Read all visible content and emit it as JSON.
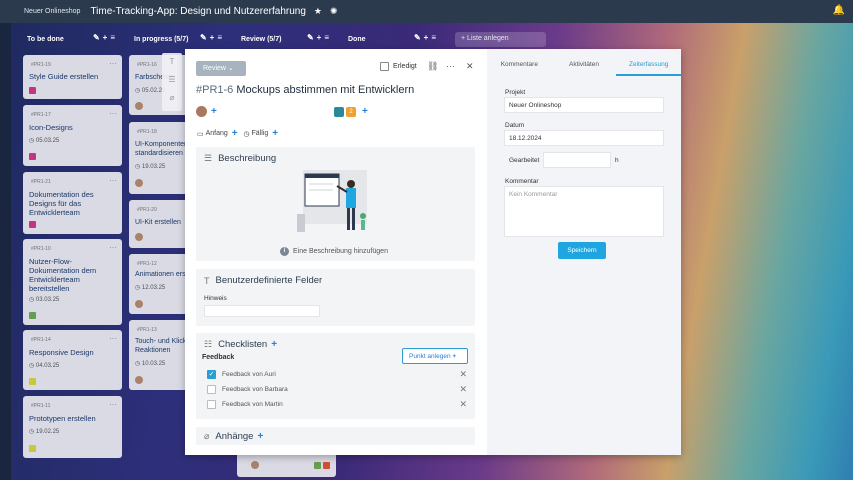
{
  "topbar": {
    "workspace": "Neuer Onlineshop",
    "title": "Time-Tracking-App: Design und Nutzererfahrung"
  },
  "columns": [
    {
      "name": "To be done",
      "count": ""
    },
    {
      "name": "In progress",
      "count": "(5/7)"
    },
    {
      "name": "Review",
      "count": "(5/7)"
    },
    {
      "name": "Done",
      "count": ""
    }
  ],
  "add_list": "Liste anlegen",
  "todo_cards": [
    {
      "id": "#PR1-19",
      "title": "Style Guide erstellen",
      "date": "",
      "color": "#d63384"
    },
    {
      "id": "#PR1-17",
      "title": "Icon-Designs",
      "date": "05.03.25",
      "color": "#d63384"
    },
    {
      "id": "#PR1-21",
      "title": "Dokumentation des Designs für das Entwicklerteam",
      "date": "",
      "color": "#d63384"
    },
    {
      "id": "#PR1-10",
      "title": "Nutzer-Flow-Dokumentation dem Entwicklerteam bereitstellen",
      "date": "03.03.25",
      "color": "#6aa84f"
    },
    {
      "id": "#PR1-14",
      "title": "Responsive Design",
      "date": "04.03.25",
      "color": "#d6d63a"
    },
    {
      "id": "#PR1-11",
      "title": "Prototypen erstellen",
      "date": "19.02.25",
      "color": "#d6d63a"
    }
  ],
  "progress_cards": [
    {
      "id": "#PR1-16",
      "title": "Farbschema",
      "date": "05.02.25"
    },
    {
      "id": "#PR1-18",
      "title": "UI-Komponenten standardisieren",
      "date": "19.03.25"
    },
    {
      "id": "#PR1-20",
      "title": "UI-Kit erstellen",
      "date": ""
    },
    {
      "id": "#PR1-12",
      "title": "Animationen erstellen",
      "date": "12.03.25"
    },
    {
      "id": "#PR1-13",
      "title": "Touch- und Klick-Reaktionen definieren",
      "date": "10.03.25"
    }
  ],
  "modal": {
    "status": "Review",
    "erledigt": "Erledigt",
    "task_id": "#PR1-6",
    "task_title": "Mockups abstimmen mit Entwicklern",
    "tag_count": "2",
    "anfang": "Anfang",
    "faellig": "Fällig",
    "beschreibung": "Beschreibung",
    "add_description": "Eine Beschreibung hinzufügen",
    "custom_fields": "Benutzerdefinierte Felder",
    "hinweis": "Hinweis",
    "checklisten": "Checklisten",
    "feedback": "Feedback",
    "punkt_anlegen": "Punkt anlegen",
    "checklist_items": [
      {
        "label": "Feedback von Auri",
        "done": true
      },
      {
        "label": "Feedback von Barbara",
        "done": false
      },
      {
        "label": "Feedback von Martin",
        "done": false
      }
    ],
    "anhaenge": "Anhänge"
  },
  "right": {
    "tabs": [
      "Kommentare",
      "Aktivitäten",
      "Zeiterfassung"
    ],
    "projekt_label": "Projekt",
    "projekt_value": "Neuer Onlineshop",
    "datum_label": "Datum",
    "datum_value": "18.12.2024",
    "gearbeitet_label": "Gearbeitet",
    "gearbeitet_unit": "h",
    "kommentar_label": "Kommentar",
    "kommentar_placeholder": "Kein Kommentar",
    "save": "Speichern"
  },
  "colors": {
    "accent": "#1fa6e0",
    "tag_teal": "#2a8a9a",
    "tag_orange": "#f0a030"
  }
}
